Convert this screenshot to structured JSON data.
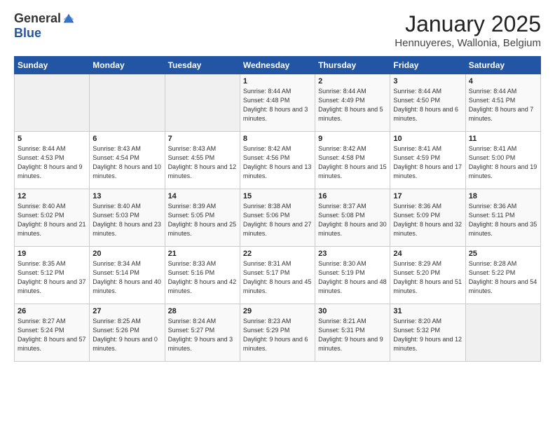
{
  "logo": {
    "general": "General",
    "blue": "Blue"
  },
  "title": "January 2025",
  "subtitle": "Hennuyeres, Wallonia, Belgium",
  "days_header": [
    "Sunday",
    "Monday",
    "Tuesday",
    "Wednesday",
    "Thursday",
    "Friday",
    "Saturday"
  ],
  "weeks": [
    [
      {
        "day": "",
        "info": ""
      },
      {
        "day": "",
        "info": ""
      },
      {
        "day": "",
        "info": ""
      },
      {
        "day": "1",
        "info": "Sunrise: 8:44 AM\nSunset: 4:48 PM\nDaylight: 8 hours\nand 3 minutes."
      },
      {
        "day": "2",
        "info": "Sunrise: 8:44 AM\nSunset: 4:49 PM\nDaylight: 8 hours\nand 5 minutes."
      },
      {
        "day": "3",
        "info": "Sunrise: 8:44 AM\nSunset: 4:50 PM\nDaylight: 8 hours\nand 6 minutes."
      },
      {
        "day": "4",
        "info": "Sunrise: 8:44 AM\nSunset: 4:51 PM\nDaylight: 8 hours\nand 7 minutes."
      }
    ],
    [
      {
        "day": "5",
        "info": "Sunrise: 8:44 AM\nSunset: 4:53 PM\nDaylight: 8 hours\nand 9 minutes."
      },
      {
        "day": "6",
        "info": "Sunrise: 8:43 AM\nSunset: 4:54 PM\nDaylight: 8 hours\nand 10 minutes."
      },
      {
        "day": "7",
        "info": "Sunrise: 8:43 AM\nSunset: 4:55 PM\nDaylight: 8 hours\nand 12 minutes."
      },
      {
        "day": "8",
        "info": "Sunrise: 8:42 AM\nSunset: 4:56 PM\nDaylight: 8 hours\nand 13 minutes."
      },
      {
        "day": "9",
        "info": "Sunrise: 8:42 AM\nSunset: 4:58 PM\nDaylight: 8 hours\nand 15 minutes."
      },
      {
        "day": "10",
        "info": "Sunrise: 8:41 AM\nSunset: 4:59 PM\nDaylight: 8 hours\nand 17 minutes."
      },
      {
        "day": "11",
        "info": "Sunrise: 8:41 AM\nSunset: 5:00 PM\nDaylight: 8 hours\nand 19 minutes."
      }
    ],
    [
      {
        "day": "12",
        "info": "Sunrise: 8:40 AM\nSunset: 5:02 PM\nDaylight: 8 hours\nand 21 minutes."
      },
      {
        "day": "13",
        "info": "Sunrise: 8:40 AM\nSunset: 5:03 PM\nDaylight: 8 hours\nand 23 minutes."
      },
      {
        "day": "14",
        "info": "Sunrise: 8:39 AM\nSunset: 5:05 PM\nDaylight: 8 hours\nand 25 minutes."
      },
      {
        "day": "15",
        "info": "Sunrise: 8:38 AM\nSunset: 5:06 PM\nDaylight: 8 hours\nand 27 minutes."
      },
      {
        "day": "16",
        "info": "Sunrise: 8:37 AM\nSunset: 5:08 PM\nDaylight: 8 hours\nand 30 minutes."
      },
      {
        "day": "17",
        "info": "Sunrise: 8:36 AM\nSunset: 5:09 PM\nDaylight: 8 hours\nand 32 minutes."
      },
      {
        "day": "18",
        "info": "Sunrise: 8:36 AM\nSunset: 5:11 PM\nDaylight: 8 hours\nand 35 minutes."
      }
    ],
    [
      {
        "day": "19",
        "info": "Sunrise: 8:35 AM\nSunset: 5:12 PM\nDaylight: 8 hours\nand 37 minutes."
      },
      {
        "day": "20",
        "info": "Sunrise: 8:34 AM\nSunset: 5:14 PM\nDaylight: 8 hours\nand 40 minutes."
      },
      {
        "day": "21",
        "info": "Sunrise: 8:33 AM\nSunset: 5:16 PM\nDaylight: 8 hours\nand 42 minutes."
      },
      {
        "day": "22",
        "info": "Sunrise: 8:31 AM\nSunset: 5:17 PM\nDaylight: 8 hours\nand 45 minutes."
      },
      {
        "day": "23",
        "info": "Sunrise: 8:30 AM\nSunset: 5:19 PM\nDaylight: 8 hours\nand 48 minutes."
      },
      {
        "day": "24",
        "info": "Sunrise: 8:29 AM\nSunset: 5:20 PM\nDaylight: 8 hours\nand 51 minutes."
      },
      {
        "day": "25",
        "info": "Sunrise: 8:28 AM\nSunset: 5:22 PM\nDaylight: 8 hours\nand 54 minutes."
      }
    ],
    [
      {
        "day": "26",
        "info": "Sunrise: 8:27 AM\nSunset: 5:24 PM\nDaylight: 8 hours\nand 57 minutes."
      },
      {
        "day": "27",
        "info": "Sunrise: 8:25 AM\nSunset: 5:26 PM\nDaylight: 9 hours\nand 0 minutes."
      },
      {
        "day": "28",
        "info": "Sunrise: 8:24 AM\nSunset: 5:27 PM\nDaylight: 9 hours\nand 3 minutes."
      },
      {
        "day": "29",
        "info": "Sunrise: 8:23 AM\nSunset: 5:29 PM\nDaylight: 9 hours\nand 6 minutes."
      },
      {
        "day": "30",
        "info": "Sunrise: 8:21 AM\nSunset: 5:31 PM\nDaylight: 9 hours\nand 9 minutes."
      },
      {
        "day": "31",
        "info": "Sunrise: 8:20 AM\nSunset: 5:32 PM\nDaylight: 9 hours\nand 12 minutes."
      },
      {
        "day": "",
        "info": ""
      }
    ]
  ]
}
